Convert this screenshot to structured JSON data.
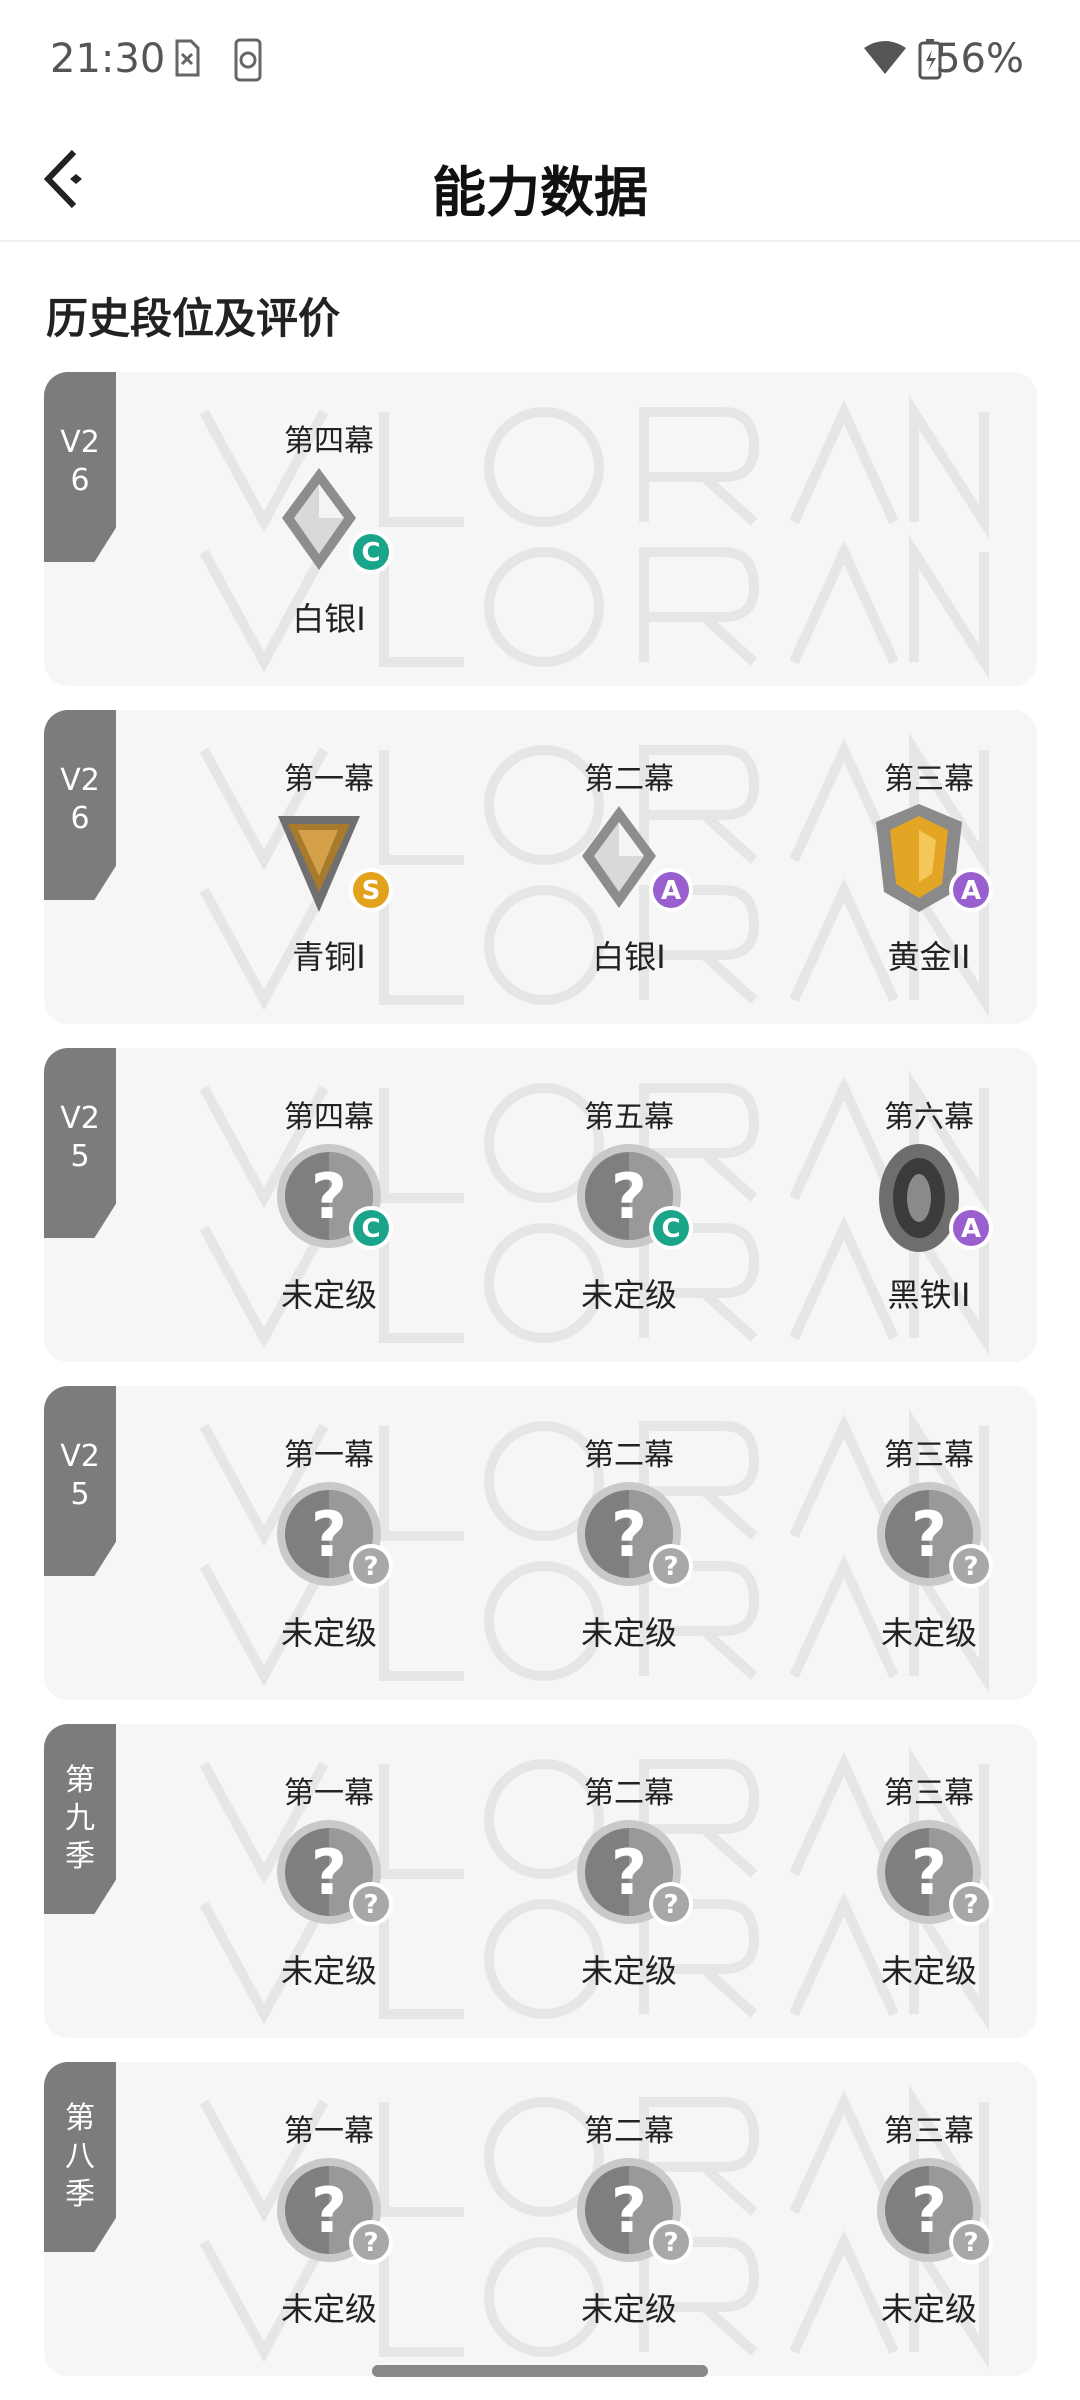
{
  "status_bar": {
    "time": "21:30",
    "battery": "56%"
  },
  "nav": {
    "title": "能力数据"
  },
  "section_title": "历史段位及评价",
  "cards": [
    {
      "tag": [
        "V2",
        "6"
      ],
      "slots": [
        {
          "act": "第四幕",
          "rank": "白银I",
          "icon": "silver",
          "grade": "C"
        }
      ]
    },
    {
      "tag": [
        "V2",
        "6"
      ],
      "slots": [
        {
          "act": "第一幕",
          "rank": "青铜I",
          "icon": "bronze",
          "grade": "S"
        },
        {
          "act": "第二幕",
          "rank": "白银I",
          "icon": "silver",
          "grade": "A"
        },
        {
          "act": "第三幕",
          "rank": "黄金II",
          "icon": "gold",
          "grade": "A"
        }
      ]
    },
    {
      "tag": [
        "V2",
        "5"
      ],
      "slots": [
        {
          "act": "第四幕",
          "rank": "未定级",
          "icon": "unranked",
          "grade": "C"
        },
        {
          "act": "第五幕",
          "rank": "未定级",
          "icon": "unranked",
          "grade": "C"
        },
        {
          "act": "第六幕",
          "rank": "黑铁II",
          "icon": "iron",
          "grade": "A"
        }
      ]
    },
    {
      "tag": [
        "V2",
        "5"
      ],
      "slots": [
        {
          "act": "第一幕",
          "rank": "未定级",
          "icon": "unranked",
          "grade": "?"
        },
        {
          "act": "第二幕",
          "rank": "未定级",
          "icon": "unranked",
          "grade": "?"
        },
        {
          "act": "第三幕",
          "rank": "未定级",
          "icon": "unranked",
          "grade": "?"
        }
      ]
    },
    {
      "tag": [
        "第",
        "九",
        "季"
      ],
      "slots": [
        {
          "act": "第一幕",
          "rank": "未定级",
          "icon": "unranked",
          "grade": "?"
        },
        {
          "act": "第二幕",
          "rank": "未定级",
          "icon": "unranked",
          "grade": "?"
        },
        {
          "act": "第三幕",
          "rank": "未定级",
          "icon": "unranked",
          "grade": "?"
        }
      ]
    },
    {
      "tag": [
        "第",
        "八",
        "季"
      ],
      "slots": [
        {
          "act": "第一幕",
          "rank": "未定级",
          "icon": "unranked",
          "grade": "?"
        },
        {
          "act": "第二幕",
          "rank": "未定级",
          "icon": "unranked",
          "grade": "?"
        },
        {
          "act": "第三幕",
          "rank": "未定级",
          "icon": "unranked",
          "grade": "?"
        }
      ]
    }
  ],
  "colors": {
    "grade_C": "#1aa58a",
    "grade_S": "#e2a21c",
    "grade_A": "#9a5fcf",
    "grade_unknown": "#a8a8a8",
    "tag": "#7c7c7c"
  }
}
